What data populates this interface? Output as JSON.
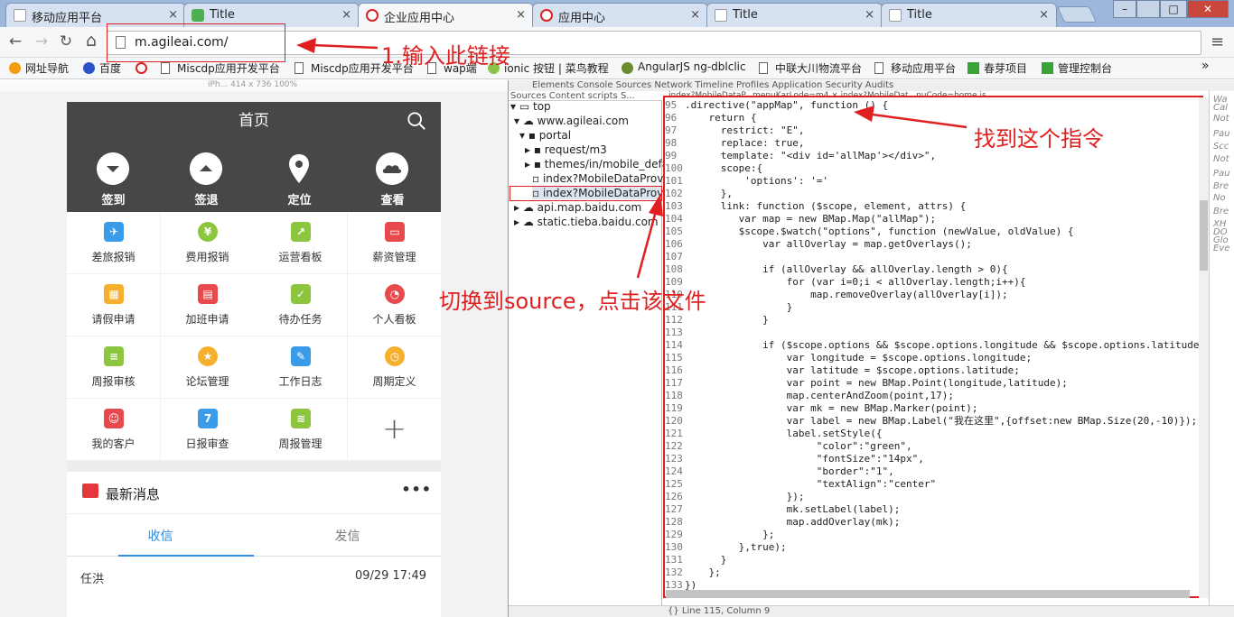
{
  "browser": {
    "tabs": [
      {
        "title": "移动应用平台",
        "active": false
      },
      {
        "title": "Title",
        "active": false
      },
      {
        "title": "企业应用中心",
        "active": true
      },
      {
        "title": "应用中心",
        "active": false
      },
      {
        "title": "Title",
        "active": false
      },
      {
        "title": "Title",
        "active": false
      }
    ],
    "close_glyph": "×",
    "window_controls": [
      "–",
      "□",
      "✕"
    ],
    "nav": {
      "back": "←",
      "forward": "→",
      "reload": "↻",
      "home": "⌂"
    },
    "url": "m.agileai.com/",
    "menu_glyph": "≡",
    "bookmarks": [
      {
        "label": "网址导航",
        "icon": "hao-icon"
      },
      {
        "label": "百度",
        "icon": "baidu-icon"
      },
      {
        "label": "",
        "icon": "red-swirl-icon"
      },
      {
        "label": "Miscdp应用开发平台",
        "icon": "page-icon"
      },
      {
        "label": "Miscdp应用开发平台",
        "icon": "page-icon"
      },
      {
        "label": "wap端",
        "icon": "page-icon"
      },
      {
        "label": "ionic 按钮 | 菜鸟教程",
        "icon": "ionic-icon"
      },
      {
        "label": "AngularJS ng-dblclic",
        "icon": "angular-icon"
      },
      {
        "label": "中联大川物流平台",
        "icon": "page-icon"
      },
      {
        "label": "移动应用平台",
        "icon": "page-icon"
      },
      {
        "label": "春芽项目",
        "icon": "sprout-icon"
      },
      {
        "label": "管理控制台",
        "icon": "sprout-icon"
      }
    ],
    "bookmarks_more": "»"
  },
  "emulator_ruler": "iPh...  414 x 736   100%",
  "phone": {
    "header_title": "首页",
    "quick_actions": [
      {
        "label": "签到",
        "icon": "chevron-down-circle-icon"
      },
      {
        "label": "签退",
        "icon": "chevron-up-circle-icon"
      },
      {
        "label": "定位",
        "icon": "map-pin-icon"
      },
      {
        "label": "查看",
        "icon": "cloud-icon"
      }
    ],
    "apps": [
      {
        "label": "差旅报销",
        "color": "#3a9be8",
        "glyph": "✈"
      },
      {
        "label": "费用报销",
        "color": "#8cc63f",
        "glyph": "¥"
      },
      {
        "label": "运营看板",
        "color": "#8cc63f",
        "glyph": "↗"
      },
      {
        "label": "薪资管理",
        "color": "#e8494c",
        "glyph": "▭"
      },
      {
        "label": "请假申请",
        "color": "#f6b02d",
        "glyph": "▦"
      },
      {
        "label": "加班申请",
        "color": "#e8494c",
        "glyph": "▤"
      },
      {
        "label": "待办任务",
        "color": "#8cc63f",
        "glyph": "✓"
      },
      {
        "label": "个人看板",
        "color": "#e8494c",
        "glyph": "◔"
      },
      {
        "label": "周报审核",
        "color": "#8cc63f",
        "glyph": "≡"
      },
      {
        "label": "论坛管理",
        "color": "#f6b02d",
        "glyph": "★"
      },
      {
        "label": "工作日志",
        "color": "#3a9be8",
        "glyph": "✎"
      },
      {
        "label": "周期定义",
        "color": "#f6b02d",
        "glyph": "◷"
      },
      {
        "label": "我的客户",
        "color": "#e8494c",
        "glyph": "☺"
      },
      {
        "label": "日报审查",
        "color": "#3a9be8",
        "glyph": "7"
      },
      {
        "label": "周报管理",
        "color": "#8cc63f",
        "glyph": "≋"
      }
    ],
    "add_glyph": "+",
    "messages": {
      "title": "最新消息",
      "more": "•••",
      "tabs": [
        "收信",
        "发信"
      ],
      "rows": [
        {
          "from": "任洪",
          "time": "09/29 17:49"
        }
      ]
    }
  },
  "devtools": {
    "panel_tabs": "Elements  Console  Sources  Network  Timeline  Profiles  Application  Security  Audits",
    "sources_subtabs": "Sources  Content scripts  S...",
    "file_tree": [
      {
        "label": "top",
        "depth": 0
      },
      {
        "label": "www.agileai.com",
        "depth": 1
      },
      {
        "label": "portal",
        "depth": 2
      },
      {
        "label": "request/m3",
        "depth": 3
      },
      {
        "label": "themes/in/mobile_default",
        "depth": 3
      },
      {
        "label": "index?MobileDataProvider",
        "depth": 3
      },
      {
        "label": "index?MobileDataProvider",
        "depth": 3
      },
      {
        "label": "api.map.baidu.com",
        "depth": 1
      },
      {
        "label": "static.tieba.baidu.com",
        "depth": 1
      }
    ],
    "open_files": "index?MobileDataP...menuKarLode=m4 ×   index?MobileDat...nuCode=home.js",
    "code_lines": [
      {
        "n": "95",
        "text": ".directive(\"appMap\", function () {"
      },
      {
        "n": "96",
        "text": "    return {"
      },
      {
        "n": "97",
        "text": "      restrict: \"E\","
      },
      {
        "n": "98",
        "text": "      replace: true,"
      },
      {
        "n": "99",
        "text": "      template: \"<div id='allMap'></div>\","
      },
      {
        "n": "100",
        "text": "      scope:{"
      },
      {
        "n": "101",
        "text": "          'options': '='"
      },
      {
        "n": "102",
        "text": "      },"
      },
      {
        "n": "103",
        "text": "      link: function ($scope, element, attrs) {"
      },
      {
        "n": "104",
        "text": "         var map = new BMap.Map(\"allMap\");"
      },
      {
        "n": "105",
        "text": "         $scope.$watch(\"options\", function (newValue, oldValue) {"
      },
      {
        "n": "106",
        "text": "             var allOverlay = map.getOverlays();"
      },
      {
        "n": "107",
        "text": ""
      },
      {
        "n": "108",
        "text": "             if (allOverlay && allOverlay.length > 0){"
      },
      {
        "n": "109",
        "text": "                 for (var i=0;i < allOverlay.length;i++){"
      },
      {
        "n": "110",
        "text": "                     map.removeOverlay(allOverlay[i]);"
      },
      {
        "n": "111",
        "text": "                 }"
      },
      {
        "n": "112",
        "text": "             }"
      },
      {
        "n": "113",
        "text": ""
      },
      {
        "n": "114",
        "text": "             if ($scope.options && $scope.options.longitude && $scope.options.latitude){"
      },
      {
        "n": "115",
        "text": "                 var longitude = $scope.options.longitude;"
      },
      {
        "n": "116",
        "text": "                 var latitude = $scope.options.latitude;"
      },
      {
        "n": "117",
        "text": "                 var point = new BMap.Point(longitude,latitude);"
      },
      {
        "n": "118",
        "text": "                 map.centerAndZoom(point,17);"
      },
      {
        "n": "119",
        "text": "                 var mk = new BMap.Marker(point);"
      },
      {
        "n": "120",
        "text": "                 var label = new BMap.Label(\"我在这里\",{offset:new BMap.Size(20,-10)});"
      },
      {
        "n": "121",
        "text": "                 label.setStyle({"
      },
      {
        "n": "122",
        "text": "                      \"color\":\"green\","
      },
      {
        "n": "123",
        "text": "                      \"fontSize\":\"14px\","
      },
      {
        "n": "124",
        "text": "                      \"border\":\"1\","
      },
      {
        "n": "125",
        "text": "                      \"textAlign\":\"center\""
      },
      {
        "n": "126",
        "text": "                 });"
      },
      {
        "n": "127",
        "text": "                 mk.setLabel(label);"
      },
      {
        "n": "128",
        "text": "                 map.addOverlay(mk);"
      },
      {
        "n": "129",
        "text": "             };"
      },
      {
        "n": "130",
        "text": "         },true);"
      },
      {
        "n": "131",
        "text": "      }"
      },
      {
        "n": "132",
        "text": "    };"
      },
      {
        "n": "133",
        "text": "})"
      }
    ],
    "right_panel": [
      "Wa",
      "Cal",
      "Not",
      "Pau",
      "Scc",
      "Not",
      "Pau",
      "Bre",
      "No",
      "Bre",
      "XH",
      "DO",
      "Glo",
      "Eve"
    ],
    "status": "{}  Line 115, Column 9"
  },
  "annotations": {
    "step1": "1.输入此链接",
    "find_directive": "找到这个指令",
    "switch_source": "切换到source，点击该文件",
    "arrow_color": "#e02020"
  }
}
